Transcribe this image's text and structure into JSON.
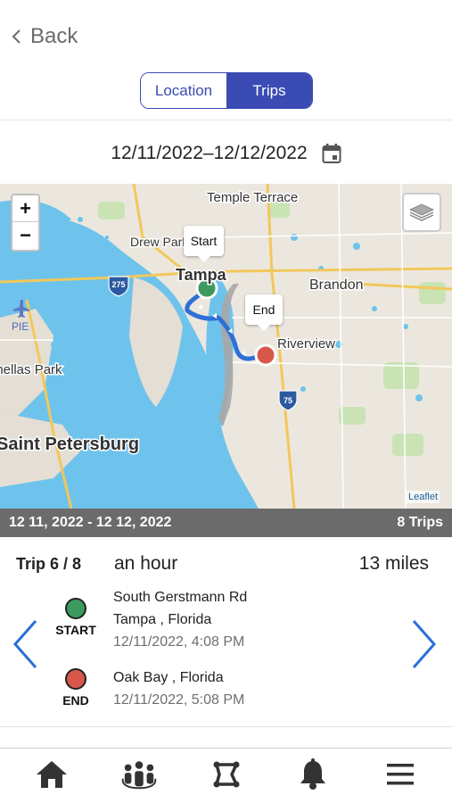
{
  "nav": {
    "back_label": "Back"
  },
  "segmented": {
    "location_label": "Location",
    "trips_label": "Trips",
    "selected": "Trips"
  },
  "date_range": {
    "value": "12/11/2022–12/12/2022",
    "icon": "calendar-icon"
  },
  "map": {
    "zoom_in": "+",
    "zoom_out": "−",
    "start_tooltip": "Start",
    "end_tooltip": "End",
    "attribution": "Leaflet",
    "place_labels": [
      "Temple Terrace",
      "Drew Park",
      "Tampa",
      "Brandon",
      "Riverview",
      "Pinellas Park",
      "Saint Petersburg"
    ],
    "highway_shields": [
      "275",
      "75",
      "PIE"
    ],
    "route_color": "#2f6fd6",
    "water_color": "#6ec3ec"
  },
  "summary": {
    "range": "12 11, 2022 - 12 12, 2022",
    "count": "8 Trips"
  },
  "trip": {
    "index": "Trip 6 / 8",
    "duration": "an hour",
    "distance": "13 miles",
    "start": {
      "label": "START",
      "line1": "South Gerstmann Rd",
      "line2": "Tampa , Florida",
      "time": "12/11/2022, 4:08 PM",
      "color": "#3c9a5f"
    },
    "end": {
      "label": "END",
      "line1": "Oak Bay , Florida",
      "time": "12/11/2022, 5:08 PM",
      "color": "#d8574b"
    }
  },
  "tabbar": {
    "items": [
      "home-icon",
      "family-icon",
      "geofence-icon",
      "bell-icon",
      "menu-icon"
    ]
  },
  "colors": {
    "accent": "#3a4bb3",
    "arrow": "#2a6fd8",
    "summary_bar": "#6b6b6b"
  }
}
